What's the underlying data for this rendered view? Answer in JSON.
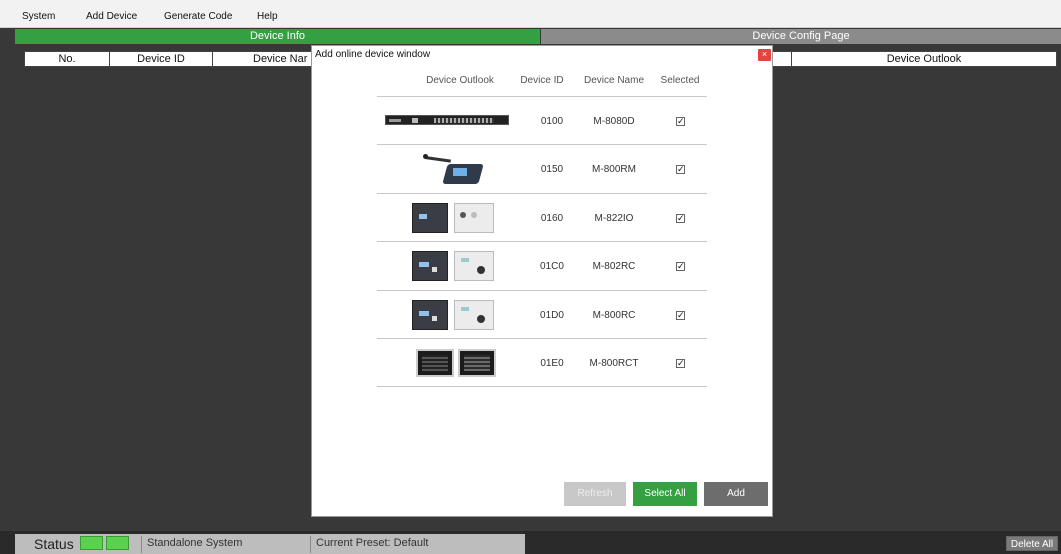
{
  "menu": [
    "System",
    "Add Device",
    "Generate Code",
    "Help"
  ],
  "tabs": {
    "device_info": "Device Info",
    "config_page": "Device Config Page"
  },
  "table_header": {
    "no": "No.",
    "device_id": "Device ID",
    "device_name": "Device Nar",
    "device_outlook": "Device Outlook"
  },
  "modal": {
    "title": "Add online device window",
    "close": "×",
    "headers": {
      "outlook": "Device Outlook",
      "id": "Device ID",
      "name": "Device Name",
      "selected": "Selected"
    },
    "devices": [
      {
        "id": "0100",
        "name": "M-8080D",
        "icon": "rack-unit-image",
        "selected": "✓"
      },
      {
        "id": "0150",
        "name": "M-800RM",
        "icon": "paging-microphone-image",
        "selected": "✓"
      },
      {
        "id": "0160",
        "name": "M-822IO",
        "icon": "wall-io-panel-image",
        "selected": "✓"
      },
      {
        "id": "01C0",
        "name": "M-802RC",
        "icon": "wall-remote-control-image",
        "selected": "✓"
      },
      {
        "id": "01D0",
        "name": "M-800RC",
        "icon": "wall-remote-control-image",
        "selected": "✓"
      },
      {
        "id": "01E0",
        "name": "M-800RCT",
        "icon": "touch-panel-image",
        "selected": "✓"
      }
    ],
    "buttons": {
      "refresh": "Refresh",
      "select_all": "Select All",
      "add": "Add"
    }
  },
  "status": {
    "label": "Status",
    "system": "Standalone System",
    "preset": "Current Preset: Default",
    "delete_all": "Delete All"
  },
  "colors": {
    "accent_green": "#35a042",
    "led_green": "#5ad24e",
    "close_red": "#e0453f"
  }
}
